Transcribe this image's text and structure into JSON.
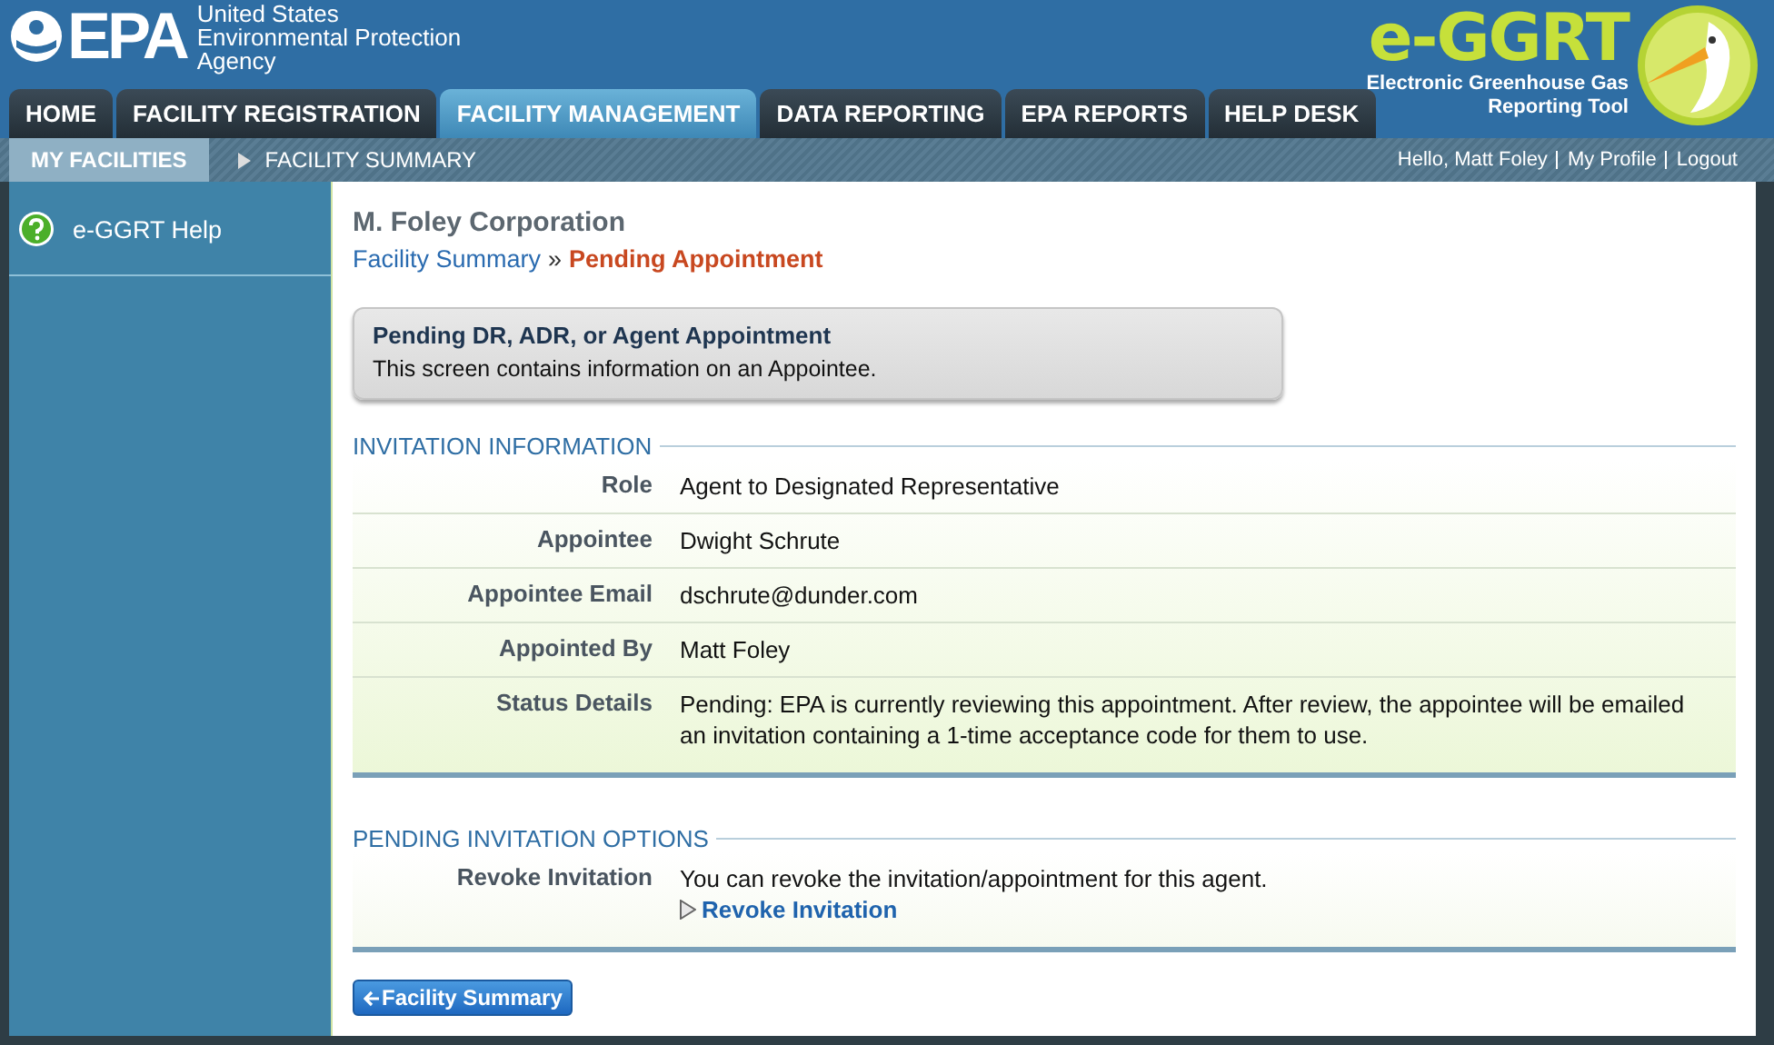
{
  "header": {
    "agency_short": "EPA",
    "agency_lines": [
      "United States",
      "Environmental Protection",
      "Agency"
    ],
    "app_name": "e-GGRT",
    "app_subtitle_lines": [
      "Electronic Greenhouse Gas",
      "Reporting Tool"
    ]
  },
  "tabs": [
    {
      "label": "HOME",
      "selected": false
    },
    {
      "label": "FACILITY REGISTRATION",
      "selected": false
    },
    {
      "label": "FACILITY MANAGEMENT",
      "selected": true
    },
    {
      "label": "DATA REPORTING",
      "selected": false
    },
    {
      "label": "EPA REPORTS",
      "selected": false
    },
    {
      "label": "HELP DESK",
      "selected": false
    }
  ],
  "subnav": [
    {
      "label": "MY FACILITIES",
      "selected": true
    },
    {
      "label": "FACILITY SUMMARY",
      "selected": false
    }
  ],
  "user_links": [
    "Hello, Matt Foley",
    "My Profile",
    "Logout"
  ],
  "sidebar": {
    "items": [
      {
        "label": "e-GGRT Help"
      }
    ]
  },
  "page": {
    "org": "M. Foley Corporation",
    "breadcrumb": {
      "link": "Facility Summary",
      "separator": "»",
      "current": "Pending Appointment"
    },
    "notice": {
      "title": "Pending DR, ADR, or Agent Appointment",
      "text": "This screen contains information on an Appointee."
    },
    "sections": [
      {
        "title": "INVITATION INFORMATION",
        "rows": [
          {
            "label": "Role",
            "value": "Agent to Designated Representative"
          },
          {
            "label": "Appointee",
            "value": "Dwight Schrute"
          },
          {
            "label": "Appointee Email",
            "value": "dschrute@dunder.com"
          },
          {
            "label": "Appointed By",
            "value": "Matt Foley"
          },
          {
            "label": "Status Details",
            "value": "Pending: EPA is currently reviewing this appointment. After review, the appointee will be emailed an invitation containing a 1-time acceptance code for them to use."
          }
        ]
      },
      {
        "title": "PENDING INVITATION OPTIONS",
        "rows": [
          {
            "label": "Revoke Invitation",
            "value": "You can revoke the invitation/appointment for this agent.",
            "link": "Revoke Invitation"
          }
        ]
      }
    ],
    "back_button": "Facility Summary"
  }
}
